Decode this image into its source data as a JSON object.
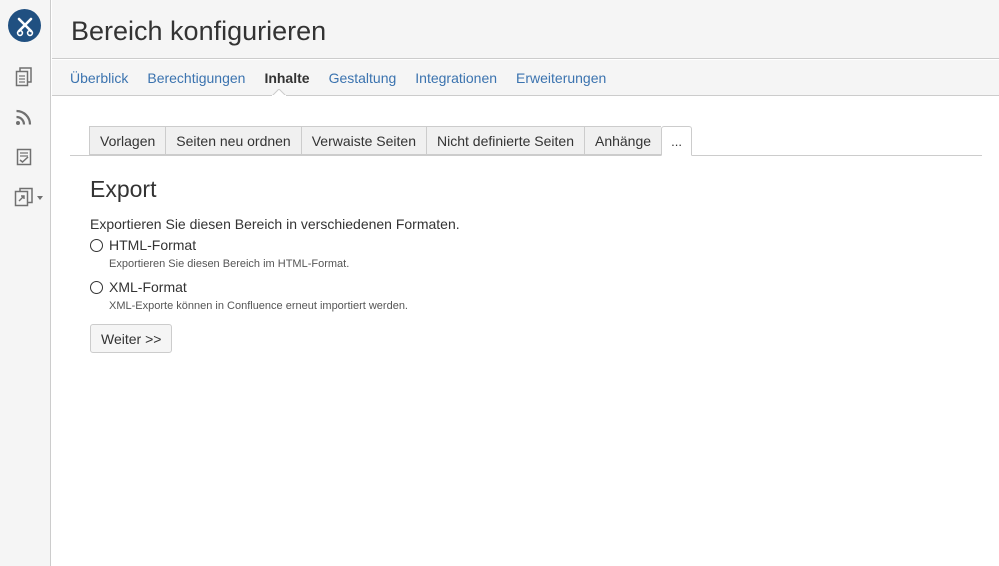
{
  "header": {
    "title": "Bereich konfigurieren"
  },
  "nav": {
    "items": [
      {
        "label": "Überblick"
      },
      {
        "label": "Berechtigungen"
      },
      {
        "label": "Inhalte"
      },
      {
        "label": "Gestaltung"
      },
      {
        "label": "Integrationen"
      },
      {
        "label": "Erweiterungen"
      }
    ],
    "active": "Inhalte"
  },
  "tabs": {
    "items": [
      {
        "label": "Vorlagen"
      },
      {
        "label": "Seiten neu ordnen"
      },
      {
        "label": "Verwaiste Seiten"
      },
      {
        "label": "Nicht definierte Seiten"
      },
      {
        "label": "Anhänge"
      },
      {
        "label": "..."
      }
    ],
    "active": "..."
  },
  "main": {
    "title": "Export",
    "intro": "Exportieren Sie diesen Bereich in verschiedenen Formaten.",
    "options": [
      {
        "label": "HTML-Format",
        "description": "Exportieren Sie diesen Bereich im HTML-Format.",
        "selected": false
      },
      {
        "label": "XML-Format",
        "description": "XML-Exporte können in Confluence erneut importiert werden.",
        "selected": false
      }
    ],
    "next_label": "Weiter >>"
  },
  "sidebar": {
    "icons": [
      "pages-icon",
      "rss-feed-icon",
      "tasks-icon",
      "space-shortcuts-icon"
    ]
  },
  "colors": {
    "brand": "#205081",
    "link": "#3b73af",
    "text": "#333333",
    "panel": "#f5f5f5",
    "border": "#cccccc"
  }
}
